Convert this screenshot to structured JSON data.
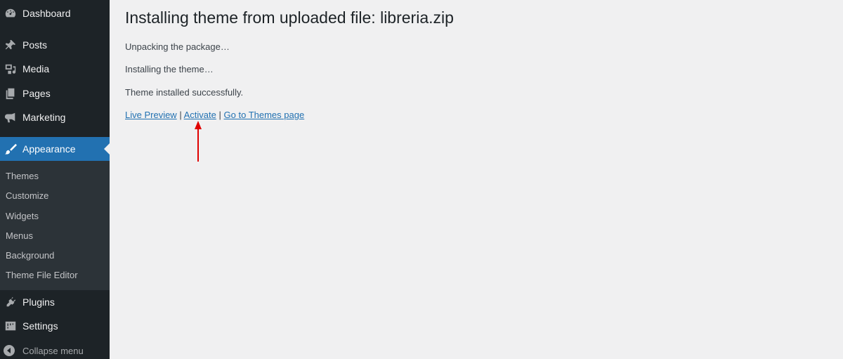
{
  "sidebar": {
    "items": [
      {
        "label": "Dashboard",
        "icon": "dashboard-icon"
      },
      {
        "label": "Posts",
        "icon": "pushpin-icon"
      },
      {
        "label": "Media",
        "icon": "media-icon"
      },
      {
        "label": "Pages",
        "icon": "pages-icon"
      },
      {
        "label": "Marketing",
        "icon": "megaphone-icon"
      },
      {
        "label": "Appearance",
        "icon": "paintbrush-icon"
      },
      {
        "label": "Plugins",
        "icon": "plugin-icon"
      },
      {
        "label": "Settings",
        "icon": "settings-icon"
      }
    ],
    "submenu": [
      "Themes",
      "Customize",
      "Widgets",
      "Menus",
      "Background",
      "Theme File Editor"
    ],
    "collapse_label": "Collapse menu"
  },
  "main": {
    "title": "Installing theme from uploaded file: libreria.zip",
    "messages": [
      "Unpacking the package…",
      "Installing the theme…",
      "Theme installed successfully."
    ],
    "links": {
      "live_preview": "Live Preview",
      "activate": "Activate",
      "themes_page": "Go to Themes page",
      "separator": "|"
    }
  },
  "colors": {
    "sidebar_bg": "#1d2327",
    "active_bg": "#2271b1",
    "link": "#2271b1",
    "annotation_arrow": "#e00000"
  }
}
